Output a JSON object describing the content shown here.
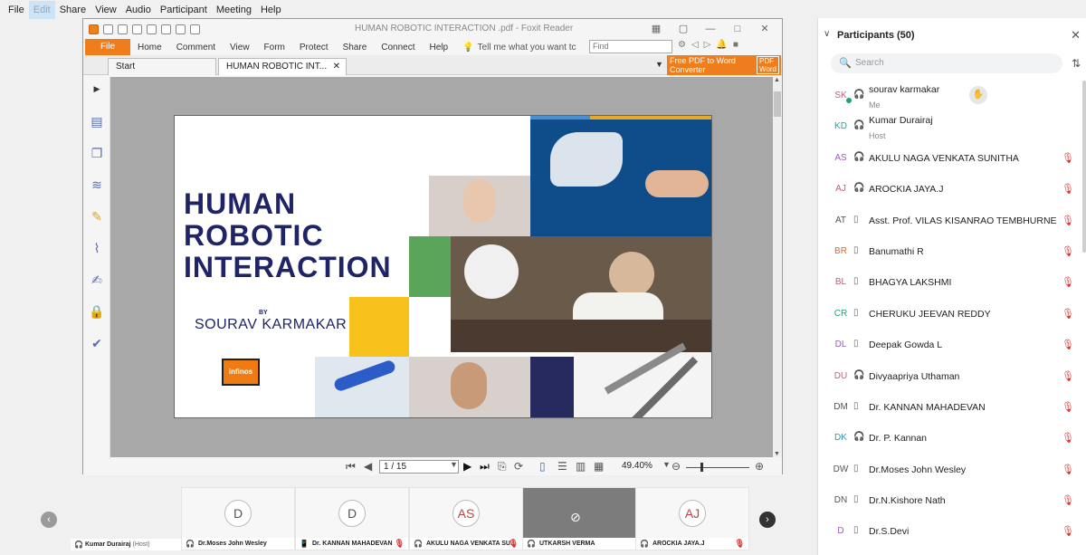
{
  "menubar": {
    "items": [
      "File",
      "Edit",
      "Share",
      "View",
      "Audio",
      "Participant",
      "Meeting",
      "Help"
    ],
    "active_index": 1
  },
  "foxit": {
    "title": "HUMAN  ROBOTIC INTERACTION .pdf - Foxit Reader",
    "file_label": "File",
    "ribbon_tabs": [
      "Home",
      "Comment",
      "View",
      "Form",
      "Protect",
      "Share",
      "Connect",
      "Help"
    ],
    "tell_me": "Tell me what you want tc",
    "find_placeholder": "Find",
    "doc_tabs": [
      "Start",
      "HUMAN  ROBOTIC INT..."
    ],
    "promo_line1": "Free PDF to Word",
    "promo_line2": "Converter",
    "promo_badge_line1": "PDF",
    "promo_badge_line2": "Word",
    "page_indicator": "1 / 15",
    "zoom": "49.40%",
    "accent_color": "#f07d1c"
  },
  "slide": {
    "title_lines": [
      "HUMAN",
      "ROBOTIC",
      "INTERACTION"
    ],
    "by": "BY",
    "author": "SOURAV KARMAKAR",
    "logo_text": "infinos",
    "title_color": "#1e2466"
  },
  "strip": {
    "first_name": "Kumar Durairaj",
    "first_host": "(Host)",
    "tiles": [
      {
        "initials": "D",
        "name": "Dr.Moses John Wesley"
      },
      {
        "initials": "D",
        "name": "Dr. KANNAN MAHADEVAN"
      },
      {
        "initials": "AS",
        "name": "AKULU NAGA VENKATA SU..."
      },
      {
        "initials": "",
        "name": "UTKARSH VERMA"
      },
      {
        "initials": "AJ",
        "name": "AROCKIA JAYA.J"
      }
    ]
  },
  "panel": {
    "title": "Participants (50)",
    "search_placeholder": "Search",
    "participants": [
      {
        "initials": "SK",
        "name": "sourav karmakar",
        "sub": "Me",
        "color": "#c0607a"
      },
      {
        "initials": "KD",
        "name": "Kumar Durairaj",
        "sub": "Host",
        "color": "#2a9d9d"
      },
      {
        "initials": "AS",
        "name": "AKULU NAGA VENKATA SUNITHA",
        "sub": "",
        "color": "#9a5fb5"
      },
      {
        "initials": "AJ",
        "name": "AROCKIA JAYA.J",
        "sub": "",
        "color": "#c0607a"
      },
      {
        "initials": "AT",
        "name": "Asst. Prof. VILAS KISANRAO TEMBHURNE",
        "sub": "",
        "color": "#555555"
      },
      {
        "initials": "BR",
        "name": "Banumathi R",
        "sub": "",
        "color": "#d46a3a"
      },
      {
        "initials": "BL",
        "name": "BHAGYA LAKSHMI",
        "sub": "",
        "color": "#c0607a"
      },
      {
        "initials": "CR",
        "name": "CHERUKU JEEVAN REDDY",
        "sub": "",
        "color": "#2a9d7a"
      },
      {
        "initials": "DL",
        "name": "Deepak Gowda L",
        "sub": "",
        "color": "#9a5fb5"
      },
      {
        "initials": "DU",
        "name": "Divyaapriya Uthaman",
        "sub": "",
        "color": "#c0607a"
      },
      {
        "initials": "DM",
        "name": "Dr. KANNAN MAHADEVAN",
        "sub": "",
        "color": "#555555"
      },
      {
        "initials": "DK",
        "name": "Dr. P. Kannan",
        "sub": "",
        "color": "#2a9dba"
      },
      {
        "initials": "DW",
        "name": "Dr.Moses John Wesley",
        "sub": "",
        "color": "#555555"
      },
      {
        "initials": "DN",
        "name": "Dr.N.Kishore Nath",
        "sub": "",
        "color": "#555555"
      },
      {
        "initials": "D",
        "name": "Dr.S.Devi",
        "sub": "",
        "color": "#9a5fb5"
      }
    ]
  }
}
